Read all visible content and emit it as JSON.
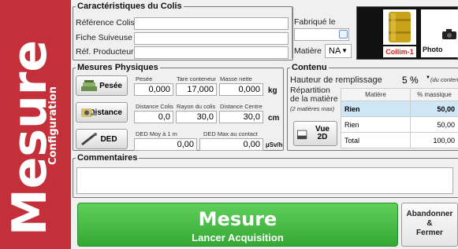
{
  "sidebar": {
    "title": "Mesure",
    "subtitle": "Configuration"
  },
  "colis": {
    "legend": "Caractéristiques du Colis",
    "ref_label": "Référence Colis",
    "ref_value": "",
    "fiche_label": "Fiche Suiveuse",
    "fiche_value": "",
    "prod_label": "Réf. Producteur",
    "prod_value": "",
    "fabrique_label": "Fabriqué le",
    "fabrique_value": "",
    "matiere_label": "Matière",
    "matiere_value": "NA"
  },
  "image": {
    "label": "Collim-1",
    "photo_label": "Photo"
  },
  "mesures": {
    "legend": "Mesures Physiques",
    "pesee_button": "Pesée",
    "pesee_label": "Pesée",
    "pesee_value": "0,000",
    "tare_label": "Tare conteneur",
    "tare_value": "17,000",
    "masse_label": "Masse nette",
    "masse_value": "0,000",
    "kg": "kg",
    "distance_button": "Distance",
    "dist_colis_label": "Distance Colis",
    "dist_colis_value": "0,0",
    "rayon_label": "Rayon du colis",
    "rayon_value": "30,0",
    "dist_centre_label": "Distance Centre",
    "dist_centre_value": "30,0",
    "cm": "cm",
    "ded_button": "DED",
    "ded_moy_label": "DED Moy à 1 m",
    "ded_moy_value": "0,00",
    "ded_max_label": "DED Max au contact",
    "ded_max_value": "0,00",
    "usvh": "µSv/h"
  },
  "contenu": {
    "legend": "Contenu",
    "hauteur_label": "Hauteur de remplissage",
    "hauteur_value": "5 %",
    "hauteur_note": "(du conteneur)",
    "repartition_label": "Répartition de la matière",
    "repartition_note": "(2 matières max)",
    "vue_button": "Vue 2D",
    "columns": [
      "Matière",
      "% massique"
    ],
    "rows": [
      {
        "matiere": "Rien",
        "pct": "50,00"
      },
      {
        "matiere": "Rien",
        "pct": "50,00"
      },
      {
        "matiere": "Total",
        "pct": "100,00"
      }
    ]
  },
  "commentaires": {
    "legend": "Commentaires",
    "value": ""
  },
  "actions": {
    "mesure_title": "Mesure",
    "mesure_sub": "Lancer Acquisition",
    "abandon_line1": "Abandonner",
    "abandon_line2": "&",
    "abandon_line3": "Fermer"
  }
}
